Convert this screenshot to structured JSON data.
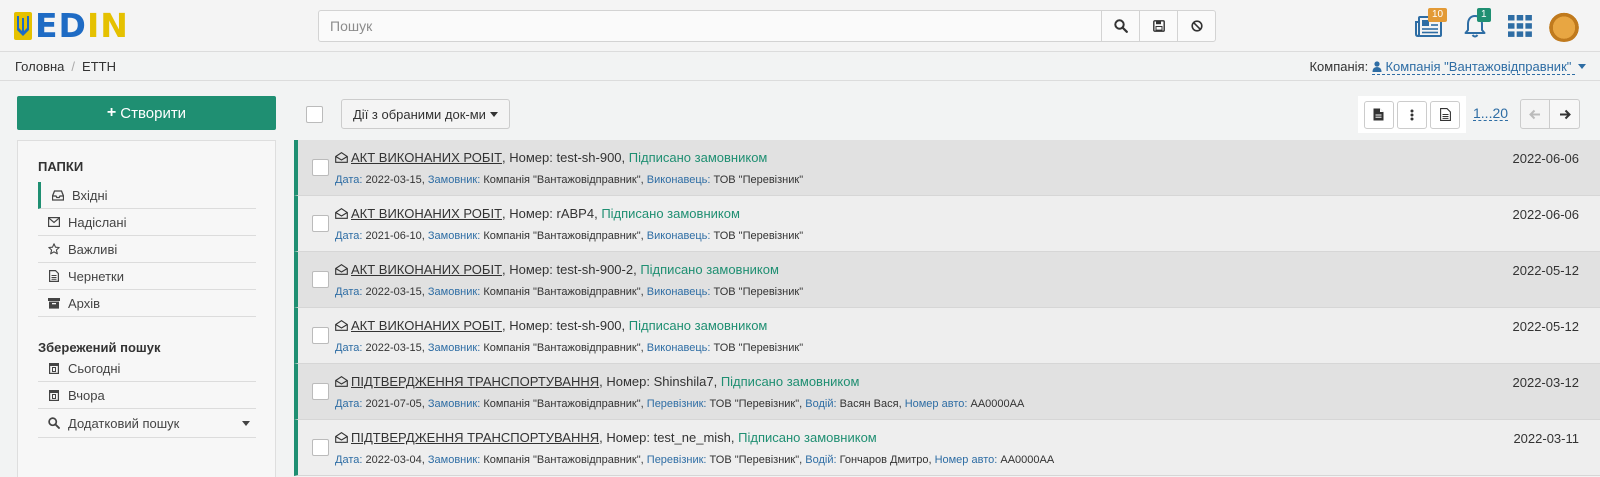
{
  "header": {
    "logo_text": "EDIN",
    "search_placeholder": "Пошук",
    "icons": [
      "search-icon",
      "save-icon",
      "ban-icon"
    ],
    "news_badge": "10",
    "notifications_badge": "1"
  },
  "breadcrumb": {
    "home": "Головна",
    "current": "ЕТТН"
  },
  "company": {
    "label": "Компанія:",
    "name": "Компанія \"Вантажовідправник\""
  },
  "create_button": "Створити",
  "sidebar": {
    "folders_title": "ПАПКИ",
    "folders": [
      {
        "label": "Вхідні",
        "icon": "inbox-icon"
      },
      {
        "label": "Надіслані",
        "icon": "envelope-icon"
      },
      {
        "label": "Важливі",
        "icon": "star-icon"
      },
      {
        "label": "Чернетки",
        "icon": "file-icon"
      },
      {
        "label": "Архів",
        "icon": "archive-icon"
      }
    ],
    "saved_title": "Збережений пошук",
    "saved": [
      {
        "label": "Сьогодні",
        "icon": "calendar-icon"
      },
      {
        "label": "Вчора",
        "icon": "calendar-icon"
      },
      {
        "label": "Додатковий пошук",
        "icon": "search-icon"
      }
    ]
  },
  "toolbar": {
    "bulk_actions": "Дії з обраними док-ми",
    "pager": "1...20"
  },
  "colors": {
    "accent": "#1f8f72",
    "link": "#2e6da4",
    "logo_blue": "#1e6bc4",
    "logo_yellow": "#e5c100"
  },
  "documents": [
    {
      "type": "АКТ ВИКОНАНИХ РОБІТ",
      "number_label": ", Номер:",
      "number": "test-sh-900",
      "status": "Підписано замовником",
      "date": "2022-06-06",
      "meta": [
        {
          "k": "Дата:",
          "v": "2022-03-15"
        },
        {
          "k": "Замовник:",
          "v": "Компанія \"Вантажовідправник\""
        },
        {
          "k": "Виконавець:",
          "v": "ТОВ \"Перевізник\""
        }
      ]
    },
    {
      "type": "АКТ ВИКОНАНИХ РОБІТ",
      "number_label": ", Номер:",
      "number": "rABP4",
      "status": "Підписано замовником",
      "date": "2022-06-06",
      "meta": [
        {
          "k": "Дата:",
          "v": "2021-06-10"
        },
        {
          "k": "Замовник:",
          "v": "Компанія \"Вантажовідправник\""
        },
        {
          "k": "Виконавець:",
          "v": "ТОВ \"Перевізник\""
        }
      ]
    },
    {
      "type": "АКТ ВИКОНАНИХ РОБІТ",
      "number_label": ", Номер:",
      "number": "test-sh-900-2",
      "status": "Підписано замовником",
      "date": "2022-05-12",
      "meta": [
        {
          "k": "Дата:",
          "v": "2022-03-15"
        },
        {
          "k": "Замовник:",
          "v": "Компанія \"Вантажовідправник\""
        },
        {
          "k": "Виконавець:",
          "v": "ТОВ \"Перевізник\""
        }
      ]
    },
    {
      "type": "АКТ ВИКОНАНИХ РОБІТ",
      "number_label": ", Номер:",
      "number": "test-sh-900",
      "status": "Підписано замовником",
      "date": "2022-05-12",
      "meta": [
        {
          "k": "Дата:",
          "v": "2022-03-15"
        },
        {
          "k": "Замовник:",
          "v": "Компанія \"Вантажовідправник\""
        },
        {
          "k": "Виконавець:",
          "v": "ТОВ \"Перевізник\""
        }
      ]
    },
    {
      "type": "ПІДТВЕРДЖЕННЯ ТРАНСПОРТУВАННЯ",
      "number_label": ", Номер:",
      "number": "Shinshila7",
      "status": "Підписано замовником",
      "date": "2022-03-12",
      "meta": [
        {
          "k": "Дата:",
          "v": "2021-07-05"
        },
        {
          "k": "Замовник:",
          "v": "Компанія \"Вантажовідправник\""
        },
        {
          "k": "Перевізник:",
          "v": "ТОВ \"Перевізник\""
        },
        {
          "k": "Водій:",
          "v": "Васян Вася"
        },
        {
          "k": "Номер авто:",
          "v": "AA0000AA"
        }
      ]
    },
    {
      "type": "ПІДТВЕРДЖЕННЯ ТРАНСПОРТУВАННЯ",
      "number_label": ", Номер:",
      "number": "test_ne_mish",
      "status": "Підписано замовником",
      "date": "2022-03-11",
      "meta": [
        {
          "k": "Дата:",
          "v": "2022-03-04"
        },
        {
          "k": "Замовник:",
          "v": "Компанія \"Вантажовідправник\""
        },
        {
          "k": "Перевізник:",
          "v": "ТОВ \"Перевізник\""
        },
        {
          "k": "Водій:",
          "v": "Гончаров Дмитро"
        },
        {
          "k": "Номер авто:",
          "v": "AA0000AA"
        }
      ]
    }
  ]
}
